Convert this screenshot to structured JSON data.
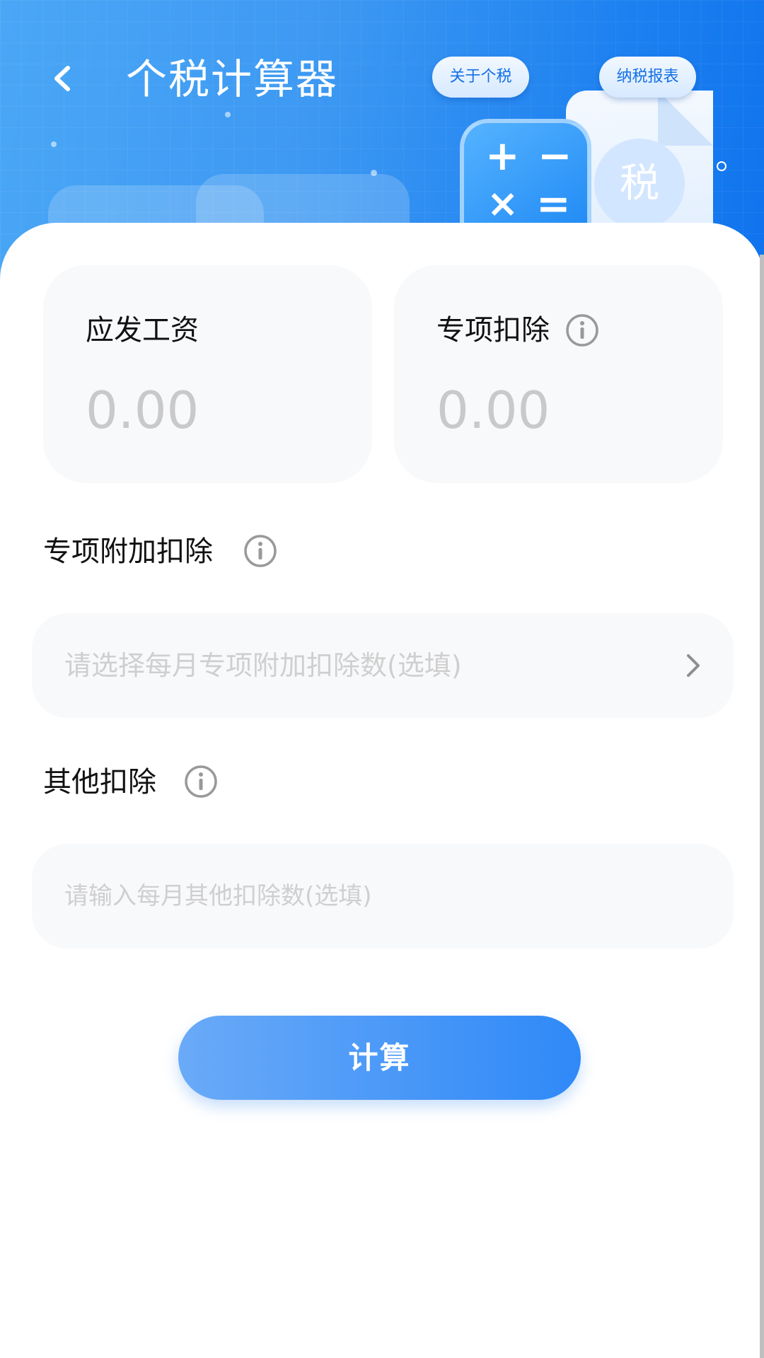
{
  "header": {
    "title": "个税计算器",
    "about_label": "关于个税",
    "report_label": "纳税报表",
    "badge_char": "税",
    "calc_symbols": {
      "plus": "+",
      "minus": "−",
      "times": "×",
      "equals": "="
    }
  },
  "cards": {
    "salary": {
      "label": "应发工资",
      "value": "0.00"
    },
    "special_deduction": {
      "label": "专项扣除",
      "value": "0.00"
    }
  },
  "additional_deduction": {
    "label": "专项附加扣除",
    "placeholder": "请选择每月专项附加扣除数(选填)"
  },
  "other_deduction": {
    "label": "其他扣除",
    "placeholder": "请输入每月其他扣除数(选填)"
  },
  "calculate_button": {
    "label": "计算"
  },
  "colors": {
    "brand": "#2f89f8",
    "header_start": "#4aa7f6",
    "header_end": "#0f73ee",
    "pill_text": "#1570e6"
  },
  "icons": {
    "back": "chevron-left-icon",
    "info": "info-circle-icon",
    "chevron": "chevron-right-icon"
  }
}
